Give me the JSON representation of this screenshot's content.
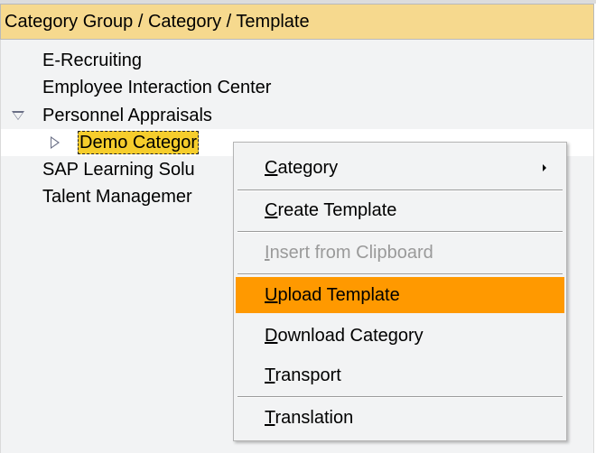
{
  "header": {
    "title": "Category Group / Category / Template"
  },
  "tree": {
    "nodes": [
      {
        "label": "E-Recruiting"
      },
      {
        "label": "Employee Interaction Center"
      },
      {
        "label": "Personnel Appraisals",
        "expanded": true
      },
      {
        "label": "Demo Categor",
        "selected": true,
        "expanded": false
      },
      {
        "label": "SAP Learning Solu"
      },
      {
        "label": "Talent Managemer"
      }
    ]
  },
  "context_menu": {
    "items": [
      {
        "label": "Category",
        "has_submenu": true
      },
      {
        "label": "Create Template"
      },
      {
        "label": "Insert from Clipboard",
        "disabled": true
      },
      {
        "label": "Upload Template",
        "highlighted": true
      },
      {
        "label": "Download Category"
      },
      {
        "label": "Transport"
      },
      {
        "label": "Translation"
      }
    ]
  },
  "colors": {
    "header_bg": "#f6d98e",
    "selection_bg": "#f6cd2c",
    "menu_highlight": "#ff9900",
    "tree_bg": "#f2f3f4"
  }
}
